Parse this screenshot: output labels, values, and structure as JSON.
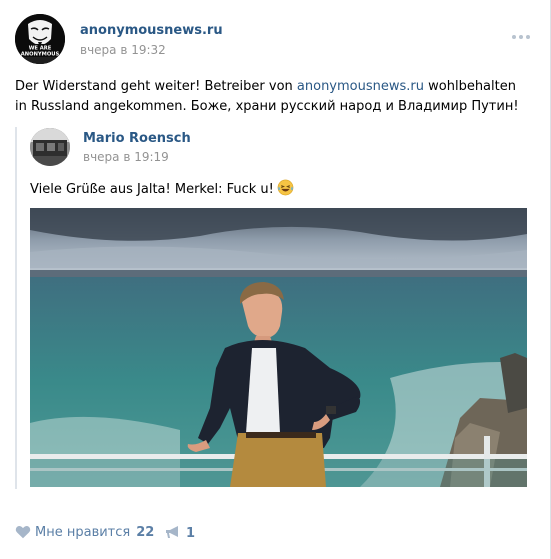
{
  "post": {
    "author": "anonymousnews.ru",
    "time": "вчера в 19:32",
    "avatar_text": "WE ARE ANONYMOUS",
    "more_icon": "more-dots-icon",
    "text_before_link": "Der Widerstand geht weiter! Betreiber von ",
    "text_link": "anonymousnews.ru",
    "text_after_link": " wohlbehalten in Russland angekommen. Боже, храни русский народ и Владимир Путин!"
  },
  "repost": {
    "author": "Mario Roensch",
    "time": "вчера в 19:19",
    "text": "Viele Grüße aus Jalta! Merkel: Fuck u!",
    "emoji": "laughing-tears-emoji",
    "photo": "man-standing-by-sea-railing"
  },
  "footer": {
    "like_label": "Мне нравится",
    "like_count": "22",
    "share_count": "1",
    "like_icon": "heart-icon",
    "share_icon": "megaphone-icon"
  },
  "colors": {
    "link": "#2a5885",
    "meta": "#939393",
    "action": "#5b7fa6"
  }
}
